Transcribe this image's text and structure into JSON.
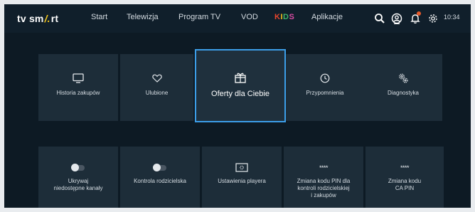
{
  "app": {
    "logo_left": "tv sm",
    "logo_mark": "/.",
    "logo_right": "rt"
  },
  "nav": {
    "items": [
      {
        "label": "Start"
      },
      {
        "label": "Telewizja"
      },
      {
        "label": "Program TV"
      },
      {
        "label": "VOD"
      },
      {
        "label": "KIDS"
      },
      {
        "label": "Aplikacje"
      }
    ],
    "kids_letter_colors": [
      "#e8452c",
      "#f6c21c",
      "#3db36a",
      "#d94ba3"
    ]
  },
  "status": {
    "clock": "10:34"
  },
  "icons": {
    "search": "search-icon",
    "profile": "user-circle-icon",
    "notifications": "bell-icon",
    "settings": "gear-icon"
  },
  "tiles_row1": [
    {
      "label": "Historia zakupów",
      "icon": "tv-icon"
    },
    {
      "label": "Ulubione",
      "icon": "heart-icon"
    },
    {
      "label": "Oferty dla Ciebie",
      "icon": "gift-icon",
      "focused": true
    },
    {
      "label": "Przypomnienia",
      "icon": "clock-icon"
    },
    {
      "label": "Diagnostyka",
      "icon": "gears-icon"
    }
  ],
  "tiles_row2": [
    {
      "label_line1": "Ukrywaj",
      "label_line2": "niedostępne kanały",
      "icon": "toggle-off-icon"
    },
    {
      "label_line1": "Kontrola rodzicielska",
      "label_line2": "",
      "icon": "toggle-off-icon"
    },
    {
      "label_line1": "Ustawienia playera",
      "label_line2": "",
      "icon": "player-settings-icon"
    },
    {
      "label_line1": "Zmiana kodu PIN dla",
      "label_line2": "kontroli rodzicielskiej",
      "label_line3": "i zakupów",
      "icon": "pin-dots-icon"
    },
    {
      "label_line1": "Zmiana kodu",
      "label_line2": "CA PIN",
      "icon": "pin-dots-icon"
    }
  ],
  "pin_dots": "****",
  "colors": {
    "background": "#0d1a24",
    "tile": "#1d2d39",
    "focus_border": "#3c9ee8",
    "logo_accent": "#f7c91b"
  }
}
